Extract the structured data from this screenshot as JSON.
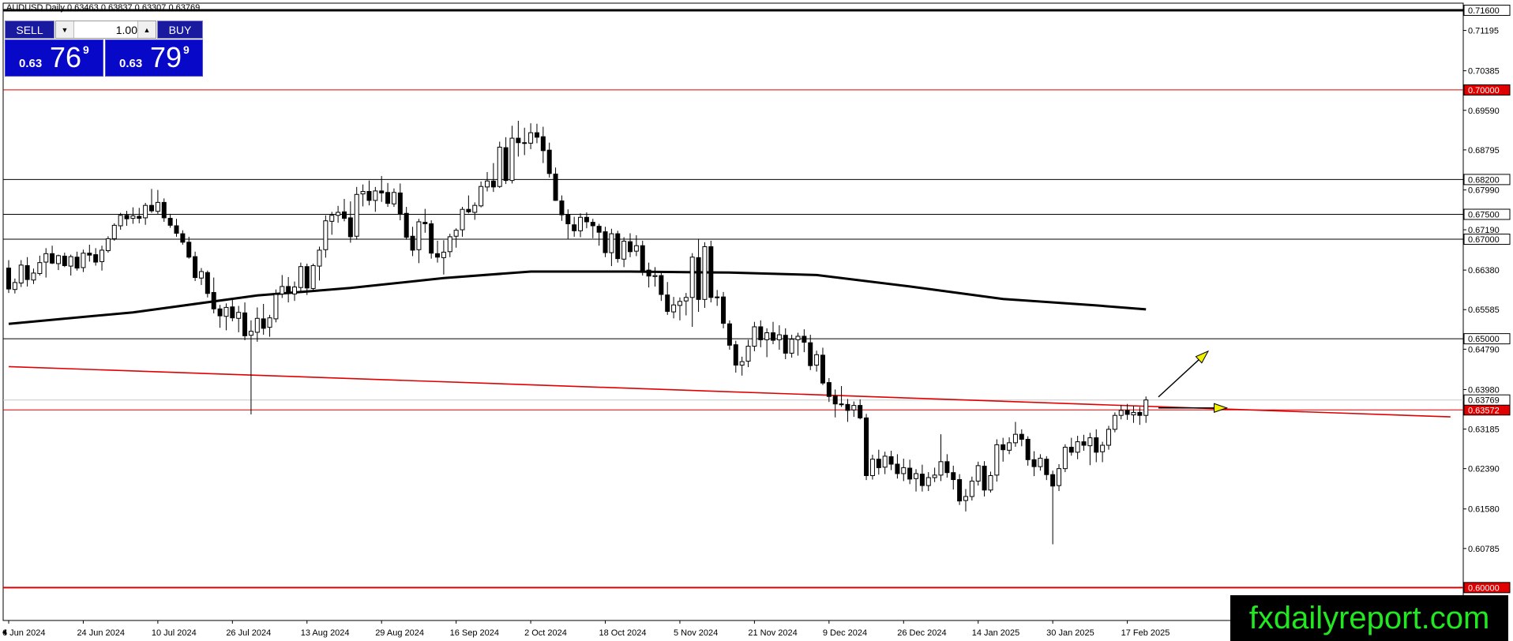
{
  "chart_title": "AUDUSD,Daily  0.63463 0.63837 0.63307 0.63769",
  "trade_panel": {
    "sell_label": "SELL",
    "buy_label": "BUY",
    "lot_value": "1.00",
    "sell_price_prefix": "0.63",
    "sell_price_big": "76",
    "sell_price_sup": "9",
    "buy_price_prefix": "0.63",
    "buy_price_big": "79",
    "buy_price_sup": "9"
  },
  "watermark": "fxdailyreport.com",
  "colors": {
    "up_candle": "#ffffff",
    "down_candle": "#000000",
    "ma_line": "#000000",
    "support_line": "#e00000",
    "highlight_label_bg": "#e00000",
    "watermark_text": "#22e822",
    "trade_panel_bg": "#0808c8",
    "arrow_fill": "#f0f000"
  },
  "chart_data": {
    "type": "candlestick",
    "title": "AUDUSD,Daily  0.63463 0.63837 0.63307 0.63769",
    "symbol": "AUDUSD",
    "timeframe": "Daily",
    "last_ohlc": {
      "open": 0.63463,
      "high": 0.63837,
      "low": 0.63307,
      "close": 0.63769
    },
    "ylim": [
      0.5945,
      0.7168
    ],
    "y_ticks": [
      0.716,
      0.71195,
      0.70385,
      0.6959,
      0.68795,
      0.6799,
      0.6719,
      0.6638,
      0.65585,
      0.6479,
      0.6398,
      0.63185,
      0.6239,
      0.6158,
      0.60785
    ],
    "y_tick_labels": [
      "0.71600",
      "0.71195",
      "0.70385",
      "0.69590",
      "0.68795",
      "0.67990",
      "0.67190",
      "0.66380",
      "0.65585",
      "0.64790",
      "0.63980",
      "0.63185",
      "0.62390",
      "0.61580",
      "0.60785"
    ],
    "x_tick_labels": [
      "6 Jun 2024",
      "24 Jun 2024",
      "10 Jul 2024",
      "26 Jul 2024",
      "13 Aug 2024",
      "29 Aug 2024",
      "16 Sep 2024",
      "2 Oct 2024",
      "18 Oct 2024",
      "5 Nov 2024",
      "21 Nov 2024",
      "9 Dec 2024",
      "26 Dec 2024",
      "14 Jan 2025",
      "30 Jan 2025",
      "17 Feb 2025"
    ],
    "x_tick_bar_index": [
      0,
      12,
      24,
      36,
      48,
      60,
      72,
      84,
      96,
      108,
      120,
      132,
      144,
      156,
      168,
      180
    ],
    "horizontal_levels": [
      {
        "price": 0.716,
        "label": "0.71600",
        "color": "#000000",
        "width": 3,
        "highlight": false
      },
      {
        "price": 0.7,
        "label": "0.70000",
        "color": "#e00000",
        "width": 1,
        "highlight": true
      },
      {
        "price": 0.682,
        "label": "0.68200",
        "color": "#000000",
        "width": 1,
        "highlight": false
      },
      {
        "price": 0.675,
        "label": "0.67500",
        "color": "#000000",
        "width": 1,
        "highlight": false
      },
      {
        "price": 0.67,
        "label": "0.67000",
        "color": "#000000",
        "width": 1,
        "highlight": false
      },
      {
        "price": 0.65,
        "label": "0.65000",
        "color": "#000000",
        "width": 1,
        "highlight": false
      },
      {
        "price": 0.6357,
        "label": "0.63572",
        "color": "#e00000",
        "width": 1,
        "highlight": true
      },
      {
        "price": 0.6,
        "label": "0.60000",
        "color": "#e00000",
        "width": 2,
        "highlight": true
      }
    ],
    "current_price": {
      "price": 0.63769,
      "label": "0.63769"
    },
    "trendline": {
      "from": {
        "bar": 0,
        "price": 0.6444
      },
      "to": {
        "bar": 232,
        "price": 0.6343
      },
      "color": "#e00000"
    },
    "moving_average": [
      {
        "bar": 0,
        "price": 0.653
      },
      {
        "bar": 20,
        "price": 0.6553
      },
      {
        "bar": 40,
        "price": 0.6587
      },
      {
        "bar": 55,
        "price": 0.6602
      },
      {
        "bar": 70,
        "price": 0.6622
      },
      {
        "bar": 84,
        "price": 0.6635
      },
      {
        "bar": 100,
        "price": 0.6635
      },
      {
        "bar": 116,
        "price": 0.6633
      },
      {
        "bar": 130,
        "price": 0.6628
      },
      {
        "bar": 145,
        "price": 0.6605
      },
      {
        "bar": 160,
        "price": 0.658
      },
      {
        "bar": 175,
        "price": 0.6567
      },
      {
        "bar": 183,
        "price": 0.6559
      }
    ],
    "arrows": [
      {
        "from": {
          "bar": 185,
          "price": 0.6383
        },
        "to": {
          "bar": 193,
          "price": 0.6475
        }
      },
      {
        "from": {
          "bar": 185,
          "price": 0.6361
        },
        "to": {
          "bar": 196,
          "price": 0.6361
        }
      }
    ],
    "candles": [
      [
        0.6642,
        0.6658,
        0.6592,
        0.66
      ],
      [
        0.6599,
        0.6621,
        0.6591,
        0.6613
      ],
      [
        0.6612,
        0.6658,
        0.6604,
        0.6648
      ],
      [
        0.6647,
        0.6664,
        0.6605,
        0.6619
      ],
      [
        0.6618,
        0.6641,
        0.661,
        0.6632
      ],
      [
        0.6631,
        0.6667,
        0.6627,
        0.6653
      ],
      [
        0.6654,
        0.6682,
        0.6623,
        0.6671
      ],
      [
        0.6671,
        0.6687,
        0.665,
        0.6652
      ],
      [
        0.6651,
        0.6669,
        0.6638,
        0.6667
      ],
      [
        0.6666,
        0.6673,
        0.6644,
        0.6647
      ],
      [
        0.6646,
        0.6669,
        0.6627,
        0.6665
      ],
      [
        0.6664,
        0.6675,
        0.6637,
        0.6642
      ],
      [
        0.6643,
        0.6679,
        0.6634,
        0.6672
      ],
      [
        0.6672,
        0.6689,
        0.6655,
        0.6668
      ],
      [
        0.6669,
        0.6682,
        0.6647,
        0.6654
      ],
      [
        0.6655,
        0.6687,
        0.6637,
        0.6678
      ],
      [
        0.6677,
        0.6706,
        0.6673,
        0.6701
      ],
      [
        0.6701,
        0.6732,
        0.6697,
        0.6728
      ],
      [
        0.6727,
        0.6753,
        0.6719,
        0.6748
      ],
      [
        0.6748,
        0.6757,
        0.6727,
        0.6741
      ],
      [
        0.6742,
        0.6764,
        0.6731,
        0.6747
      ],
      [
        0.6746,
        0.6763,
        0.6732,
        0.6742
      ],
      [
        0.6743,
        0.6773,
        0.6729,
        0.6768
      ],
      [
        0.6768,
        0.6801,
        0.6753,
        0.6757
      ],
      [
        0.6756,
        0.6799,
        0.6751,
        0.6774
      ],
      [
        0.6774,
        0.6782,
        0.6735,
        0.6743
      ],
      [
        0.6742,
        0.6751,
        0.6723,
        0.6728
      ],
      [
        0.6727,
        0.6741,
        0.6705,
        0.6712
      ],
      [
        0.6711,
        0.6718,
        0.6689,
        0.6694
      ],
      [
        0.6694,
        0.6705,
        0.6661,
        0.6664
      ],
      [
        0.6665,
        0.6675,
        0.6616,
        0.6623
      ],
      [
        0.6622,
        0.6642,
        0.6608,
        0.6635
      ],
      [
        0.6633,
        0.6637,
        0.6583,
        0.6591
      ],
      [
        0.6593,
        0.6623,
        0.6551,
        0.656
      ],
      [
        0.656,
        0.6568,
        0.6522,
        0.6546
      ],
      [
        0.6545,
        0.6571,
        0.6517,
        0.6563
      ],
      [
        0.6564,
        0.6582,
        0.6535,
        0.6542
      ],
      [
        0.6541,
        0.6566,
        0.6513,
        0.6553
      ],
      [
        0.6552,
        0.6573,
        0.6497,
        0.6506
      ],
      [
        0.6507,
        0.6537,
        0.6348,
        0.6515
      ],
      [
        0.6513,
        0.6563,
        0.6494,
        0.6541
      ],
      [
        0.654,
        0.657,
        0.6508,
        0.6521
      ],
      [
        0.6523,
        0.6548,
        0.6504,
        0.6542
      ],
      [
        0.654,
        0.6599,
        0.6533,
        0.6589
      ],
      [
        0.659,
        0.6628,
        0.6582,
        0.6605
      ],
      [
        0.6605,
        0.6624,
        0.6573,
        0.6591
      ],
      [
        0.659,
        0.6615,
        0.6576,
        0.6604
      ],
      [
        0.6603,
        0.6653,
        0.6594,
        0.6645
      ],
      [
        0.6645,
        0.6651,
        0.6588,
        0.6602
      ],
      [
        0.6601,
        0.6651,
        0.6594,
        0.6647
      ],
      [
        0.6646,
        0.6685,
        0.6617,
        0.6678
      ],
      [
        0.6679,
        0.6748,
        0.6663,
        0.6737
      ],
      [
        0.6736,
        0.6755,
        0.6709,
        0.6748
      ],
      [
        0.6748,
        0.6767,
        0.6733,
        0.6754
      ],
      [
        0.6755,
        0.6781,
        0.6736,
        0.6742
      ],
      [
        0.6743,
        0.6776,
        0.6693,
        0.6705
      ],
      [
        0.6706,
        0.6805,
        0.6699,
        0.679
      ],
      [
        0.6791,
        0.681,
        0.6766,
        0.6796
      ],
      [
        0.6796,
        0.6818,
        0.6768,
        0.6778
      ],
      [
        0.6778,
        0.6805,
        0.6755,
        0.6797
      ],
      [
        0.6797,
        0.6827,
        0.6775,
        0.6793
      ],
      [
        0.6794,
        0.6813,
        0.6765,
        0.6772
      ],
      [
        0.6771,
        0.6802,
        0.6765,
        0.6794
      ],
      [
        0.6793,
        0.6812,
        0.6738,
        0.6751
      ],
      [
        0.6752,
        0.6765,
        0.6699,
        0.6704
      ],
      [
        0.6706,
        0.6725,
        0.6666,
        0.6678
      ],
      [
        0.6679,
        0.6741,
        0.6652,
        0.6735
      ],
      [
        0.6734,
        0.6761,
        0.6713,
        0.6731
      ],
      [
        0.6731,
        0.6738,
        0.6661,
        0.6672
      ],
      [
        0.6671,
        0.6697,
        0.6653,
        0.6664
      ],
      [
        0.6663,
        0.6698,
        0.6629,
        0.6674
      ],
      [
        0.6675,
        0.6711,
        0.6664,
        0.6705
      ],
      [
        0.6706,
        0.6722,
        0.6683,
        0.6718
      ],
      [
        0.6719,
        0.6765,
        0.6705,
        0.676
      ],
      [
        0.676,
        0.6788,
        0.6752,
        0.6755
      ],
      [
        0.6754,
        0.6774,
        0.6739,
        0.6768
      ],
      [
        0.6767,
        0.6816,
        0.6764,
        0.6806
      ],
      [
        0.6805,
        0.6835,
        0.6796,
        0.6817
      ],
      [
        0.6817,
        0.6853,
        0.6795,
        0.6805
      ],
      [
        0.6806,
        0.6896,
        0.6803,
        0.6885
      ],
      [
        0.6884,
        0.6905,
        0.6811,
        0.6818
      ],
      [
        0.6818,
        0.6928,
        0.6812,
        0.6903
      ],
      [
        0.6903,
        0.6938,
        0.6866,
        0.6894
      ],
      [
        0.6894,
        0.6924,
        0.6869,
        0.6894
      ],
      [
        0.6893,
        0.6933,
        0.6881,
        0.6914
      ],
      [
        0.6914,
        0.6932,
        0.6893,
        0.6905
      ],
      [
        0.6906,
        0.6926,
        0.6853,
        0.6878
      ],
      [
        0.6879,
        0.6894,
        0.6824,
        0.6832
      ],
      [
        0.6831,
        0.6844,
        0.6777,
        0.6778
      ],
      [
        0.6777,
        0.6788,
        0.6737,
        0.6749
      ],
      [
        0.6749,
        0.676,
        0.6701,
        0.6731
      ],
      [
        0.6729,
        0.6745,
        0.6705,
        0.6717
      ],
      [
        0.6717,
        0.6752,
        0.6704,
        0.6744
      ],
      [
        0.6744,
        0.6754,
        0.6722,
        0.6735
      ],
      [
        0.6734,
        0.6741,
        0.6702,
        0.6727
      ],
      [
        0.6726,
        0.6731,
        0.6687,
        0.6714
      ],
      [
        0.6715,
        0.6725,
        0.6664,
        0.6673
      ],
      [
        0.6673,
        0.6721,
        0.6646,
        0.6711
      ],
      [
        0.6711,
        0.6717,
        0.6653,
        0.6661
      ],
      [
        0.666,
        0.6704,
        0.6644,
        0.6696
      ],
      [
        0.6695,
        0.6712,
        0.6664,
        0.6675
      ],
      [
        0.6676,
        0.6708,
        0.6666,
        0.6687
      ],
      [
        0.6687,
        0.6697,
        0.6627,
        0.6637
      ],
      [
        0.6638,
        0.6653,
        0.6603,
        0.6626
      ],
      [
        0.6625,
        0.6644,
        0.6605,
        0.6627
      ],
      [
        0.6627,
        0.6634,
        0.6576,
        0.6589
      ],
      [
        0.6588,
        0.6614,
        0.6548,
        0.6555
      ],
      [
        0.6554,
        0.6584,
        0.6541,
        0.6568
      ],
      [
        0.6567,
        0.6583,
        0.6537,
        0.6575
      ],
      [
        0.6576,
        0.6592,
        0.6547,
        0.6583
      ],
      [
        0.6583,
        0.6672,
        0.6524,
        0.6664
      ],
      [
        0.6663,
        0.6701,
        0.6554,
        0.6579
      ],
      [
        0.6579,
        0.6694,
        0.6562,
        0.6685
      ],
      [
        0.6685,
        0.6697,
        0.6573,
        0.6583
      ],
      [
        0.6584,
        0.6598,
        0.6566,
        0.6584
      ],
      [
        0.6584,
        0.6594,
        0.6521,
        0.6531
      ],
      [
        0.653,
        0.6537,
        0.6478,
        0.6487
      ],
      [
        0.6488,
        0.6496,
        0.6432,
        0.6447
      ],
      [
        0.6447,
        0.6464,
        0.6426,
        0.6454
      ],
      [
        0.6455,
        0.6498,
        0.6443,
        0.6485
      ],
      [
        0.6485,
        0.6534,
        0.6475,
        0.6524
      ],
      [
        0.6524,
        0.6537,
        0.6483,
        0.6498
      ],
      [
        0.6498,
        0.6521,
        0.6463,
        0.6512
      ],
      [
        0.6512,
        0.6534,
        0.6489,
        0.6497
      ],
      [
        0.6498,
        0.6527,
        0.6478,
        0.6508
      ],
      [
        0.6507,
        0.6521,
        0.6459,
        0.6471
      ],
      [
        0.6471,
        0.6508,
        0.6462,
        0.6499
      ],
      [
        0.6498,
        0.6512,
        0.6466,
        0.6505
      ],
      [
        0.6505,
        0.6519,
        0.6473,
        0.6493
      ],
      [
        0.6492,
        0.6508,
        0.6437,
        0.6446
      ],
      [
        0.6447,
        0.6476,
        0.6434,
        0.6468
      ],
      [
        0.6467,
        0.6482,
        0.6407,
        0.6411
      ],
      [
        0.6412,
        0.6421,
        0.6373,
        0.6384
      ],
      [
        0.6385,
        0.6398,
        0.6342,
        0.6369
      ],
      [
        0.6369,
        0.6405,
        0.6363,
        0.6368
      ],
      [
        0.6368,
        0.6379,
        0.6333,
        0.6356
      ],
      [
        0.6357,
        0.6374,
        0.6343,
        0.6366
      ],
      [
        0.6366,
        0.6378,
        0.6338,
        0.6341
      ],
      [
        0.6341,
        0.6349,
        0.6216,
        0.6225
      ],
      [
        0.6225,
        0.6267,
        0.6217,
        0.6258
      ],
      [
        0.6258,
        0.6277,
        0.6227,
        0.6241
      ],
      [
        0.6242,
        0.6273,
        0.6228,
        0.6264
      ],
      [
        0.6263,
        0.6275,
        0.6236,
        0.6248
      ],
      [
        0.6248,
        0.6268,
        0.6219,
        0.6229
      ],
      [
        0.6229,
        0.6259,
        0.6214,
        0.6241
      ],
      [
        0.624,
        0.6257,
        0.6208,
        0.6218
      ],
      [
        0.6219,
        0.6238,
        0.6193,
        0.6229
      ],
      [
        0.6228,
        0.6247,
        0.6193,
        0.6205
      ],
      [
        0.6205,
        0.6232,
        0.6194,
        0.6221
      ],
      [
        0.6221,
        0.6241,
        0.6212,
        0.6226
      ],
      [
        0.6226,
        0.6308,
        0.6214,
        0.6253
      ],
      [
        0.6253,
        0.6268,
        0.6221,
        0.6231
      ],
      [
        0.6231,
        0.6245,
        0.6197,
        0.6217
      ],
      [
        0.6217,
        0.6228,
        0.6166,
        0.6174
      ],
      [
        0.6175,
        0.6198,
        0.6153,
        0.6183
      ],
      [
        0.6183,
        0.6223,
        0.6175,
        0.6214
      ],
      [
        0.6214,
        0.6253,
        0.6205,
        0.6245
      ],
      [
        0.6244,
        0.6254,
        0.6183,
        0.6196
      ],
      [
        0.6196,
        0.6233,
        0.6191,
        0.6225
      ],
      [
        0.6226,
        0.6298,
        0.6213,
        0.6287
      ],
      [
        0.6287,
        0.6301,
        0.6253,
        0.6277
      ],
      [
        0.6276,
        0.6302,
        0.6268,
        0.6291
      ],
      [
        0.6291,
        0.6333,
        0.6283,
        0.6308
      ],
      [
        0.6308,
        0.6318,
        0.6284,
        0.6298
      ],
      [
        0.6298,
        0.6304,
        0.6245,
        0.6257
      ],
      [
        0.6257,
        0.6274,
        0.6224,
        0.6243
      ],
      [
        0.6243,
        0.6268,
        0.6235,
        0.626
      ],
      [
        0.6258,
        0.6264,
        0.6216,
        0.6227
      ],
      [
        0.6227,
        0.6235,
        0.6087,
        0.6204
      ],
      [
        0.6205,
        0.6248,
        0.6194,
        0.6239
      ],
      [
        0.6239,
        0.6288,
        0.6232,
        0.6282
      ],
      [
        0.6282,
        0.6301,
        0.6265,
        0.6272
      ],
      [
        0.6272,
        0.6305,
        0.6258,
        0.6293
      ],
      [
        0.6293,
        0.6307,
        0.6275,
        0.6286
      ],
      [
        0.6285,
        0.6311,
        0.6246,
        0.6301
      ],
      [
        0.6301,
        0.6318,
        0.6252,
        0.6272
      ],
      [
        0.6273,
        0.6293,
        0.6252,
        0.6286
      ],
      [
        0.6286,
        0.6325,
        0.6277,
        0.6318
      ],
      [
        0.6318,
        0.6352,
        0.6312,
        0.6346
      ],
      [
        0.6346,
        0.6367,
        0.6338,
        0.6356
      ],
      [
        0.6356,
        0.6369,
        0.6337,
        0.6348
      ],
      [
        0.6347,
        0.6365,
        0.6331,
        0.6352
      ],
      [
        0.6352,
        0.6363,
        0.6327,
        0.6346
      ],
      [
        0.6346,
        0.6384,
        0.6331,
        0.6377
      ]
    ]
  }
}
